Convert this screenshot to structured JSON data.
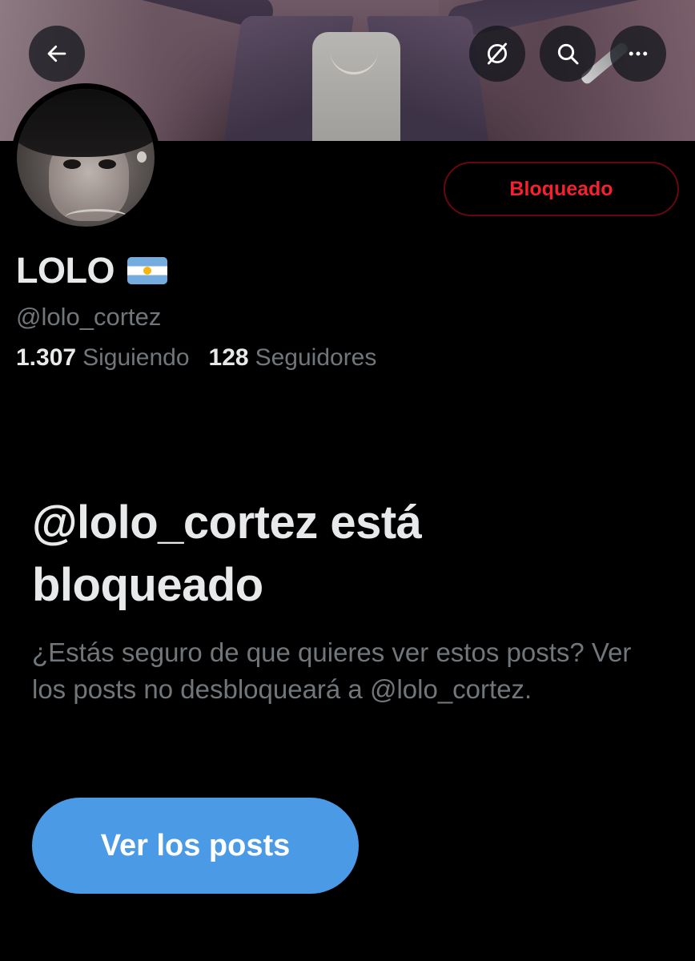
{
  "header": {
    "back_icon": "arrow-left-icon",
    "grok_icon": "grok-icon",
    "search_icon": "search-icon",
    "more_icon": "more-horizontal-icon"
  },
  "profile": {
    "name": "LOLO",
    "flag_icon": "argentina-flag-icon",
    "handle": "@lolo_cortez",
    "following_count": "1.307",
    "following_label": "Siguiendo",
    "followers_count": "128",
    "followers_label": "Seguidores",
    "blocked_button_label": "Bloqueado"
  },
  "blocked_notice": {
    "title": "@lolo_cortez está bloqueado",
    "message": "¿Estás seguro de que quieres ver estos posts? Ver los posts no desbloqueará a @lolo_cortez.",
    "view_posts_label": "Ver los posts"
  },
  "colors": {
    "background": "#000000",
    "primary_text": "#e7e9ea",
    "secondary_text": "#71767b",
    "blocked_red": "#f4212e",
    "blocked_border": "#67070f",
    "button_blue": "#4a9ae6"
  }
}
